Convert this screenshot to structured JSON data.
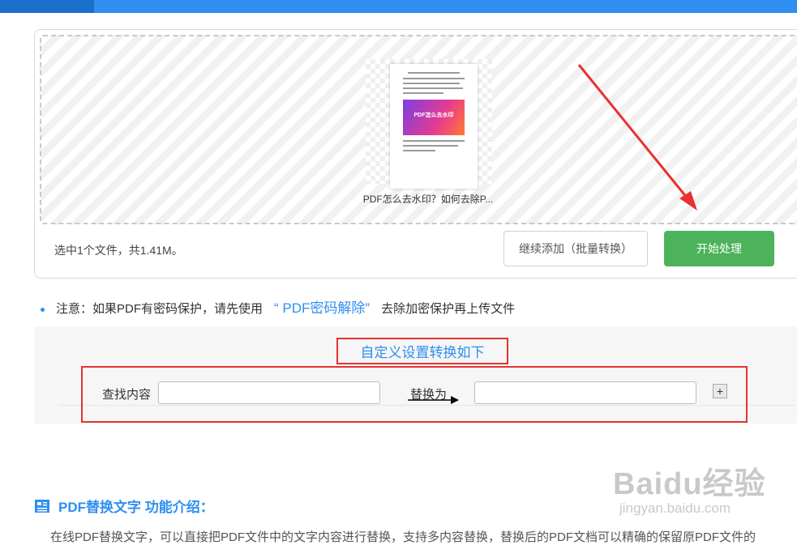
{
  "colors": {
    "accent": "#2f8ff0",
    "start_button": "#4cb35a",
    "highlight": "#e63232"
  },
  "upload": {
    "file_name": "PDF怎么去水印？如何去除P...",
    "thumbnail_banner": "PDF怎么去水印",
    "summary": "选中1个文件，共1.41M。",
    "add_button": "继续添加（批量转换）",
    "start_button": "开始处理"
  },
  "notice": {
    "prefix": "注意：如果PDF有密码保护，请先使用",
    "link": "“ PDF密码解除”",
    "suffix": "去除加密保护再上传文件"
  },
  "custom": {
    "title": "自定义设置转换如下",
    "find_label": "查找内容",
    "find_value": "",
    "replace_label": "替换为",
    "replace_value": "",
    "add_row_button": "+"
  },
  "intro": {
    "title": "PDF替换文字 功能介绍：",
    "text": "在线PDF替换文字，可以直接把PDF文件中的文字内容进行替换，支持多内容替换，替换后的PDF文档可以精确的保留原PDF文件的"
  },
  "watermark": {
    "brand": "Baidu经验",
    "url": "jingyan.baidu.com"
  }
}
